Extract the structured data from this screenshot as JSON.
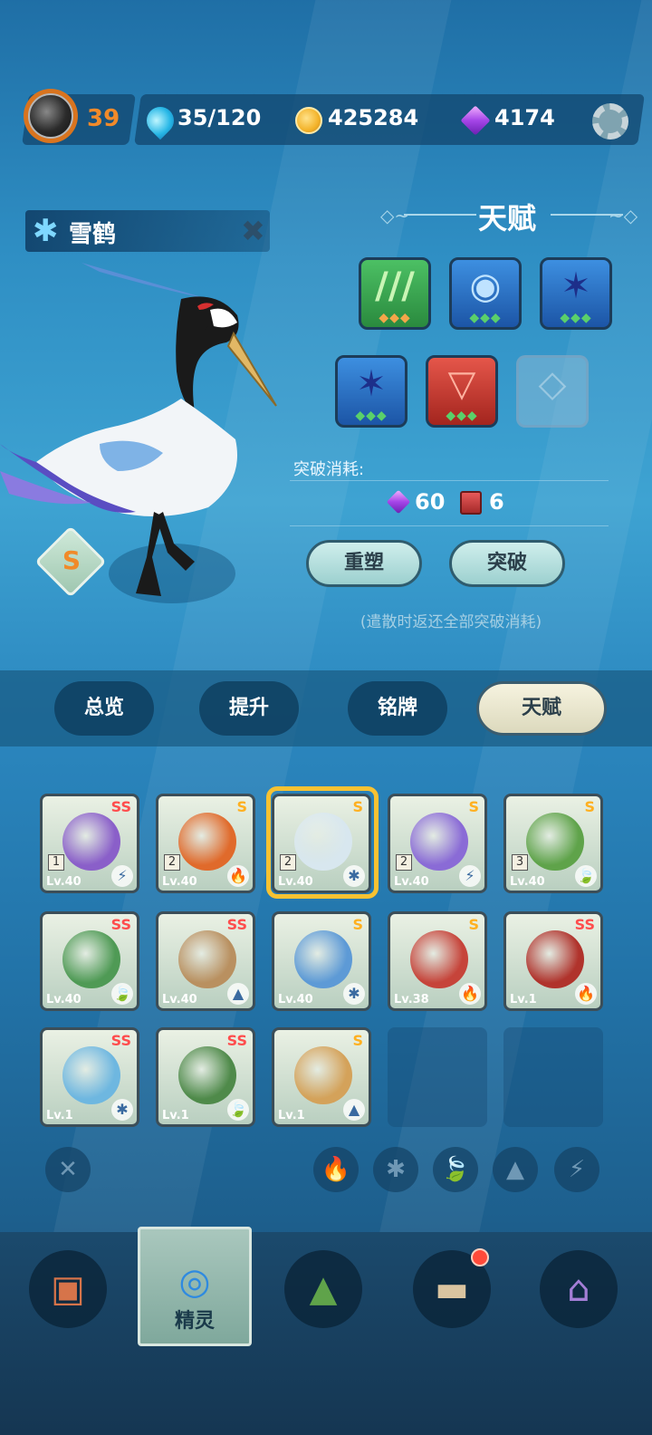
{
  "header": {
    "player_level": "39",
    "stamina": "35/120",
    "coins": "425284",
    "gems": "4174"
  },
  "spirit": {
    "name": "雪鹤",
    "rank": "S"
  },
  "talent": {
    "title": "天赋",
    "break_label": "突破消耗:",
    "cost_gems": "60",
    "cost_books": "6",
    "reshape_label": "重塑",
    "break_label_btn": "突破",
    "hint": "(遣散时返还全部突破消耗)",
    "slots": [
      {
        "glyph": "///",
        "color": "green",
        "pips": "◆◆◆"
      },
      {
        "glyph": "◉",
        "color": "blue",
        "pips": "◆◆◆"
      },
      {
        "glyph": "✶",
        "color": "blue",
        "pips": "◆◆◆"
      },
      {
        "glyph": "✶",
        "color": "blue",
        "pips": "◆◆◆"
      },
      {
        "glyph": "▽",
        "color": "red",
        "pips": "◆◆◆"
      },
      {
        "glyph": "◇",
        "color": "empty",
        "pips": ""
      }
    ]
  },
  "tabs": [
    {
      "label": "总览"
    },
    {
      "label": "提升"
    },
    {
      "label": "铭牌"
    },
    {
      "label": "天赋"
    }
  ],
  "spirits": [
    {
      "rank": "SS",
      "star": "1",
      "lv": "Lv.40",
      "elem": "⚡",
      "color": "#8a5fc9"
    },
    {
      "rank": "S",
      "star": "2",
      "lv": "Lv.40",
      "elem": "🔥",
      "color": "#e06a2b"
    },
    {
      "rank": "S",
      "star": "2",
      "lv": "Lv.40",
      "elem": "✱",
      "color": "#d8e7ef"
    },
    {
      "rank": "S",
      "star": "2",
      "lv": "Lv.40",
      "elem": "⚡",
      "color": "#8a6bd6"
    },
    {
      "rank": "S",
      "star": "3",
      "lv": "Lv.40",
      "elem": "🍃",
      "color": "#5fa34a"
    },
    {
      "rank": "SS",
      "star": "",
      "lv": "Lv.40",
      "elem": "🍃",
      "color": "#4f9a55"
    },
    {
      "rank": "SS",
      "star": "",
      "lv": "Lv.40",
      "elem": "▲",
      "color": "#b99060"
    },
    {
      "rank": "S",
      "star": "",
      "lv": "Lv.40",
      "elem": "✱",
      "color": "#5d9ad6"
    },
    {
      "rank": "S",
      "star": "",
      "lv": "Lv.38",
      "elem": "🔥",
      "color": "#c6443a"
    },
    {
      "rank": "SS",
      "star": "",
      "lv": "Lv.1",
      "elem": "🔥",
      "color": "#b0332c"
    },
    {
      "rank": "SS",
      "star": "",
      "lv": "Lv.1",
      "elem": "✱",
      "color": "#6eb7e0"
    },
    {
      "rank": "SS",
      "star": "",
      "lv": "Lv.1",
      "elem": "🍃",
      "color": "#4f8a4a"
    },
    {
      "rank": "S",
      "star": "",
      "lv": "Lv.1",
      "elem": "▲",
      "color": "#d4a25a"
    }
  ],
  "filters": [
    "✕",
    "🔥",
    "✱",
    "🍃",
    "▲",
    "⚡"
  ],
  "nav": {
    "active_label": "精灵"
  },
  "colors": {
    "accent_orange": "#f08a2a",
    "rank_ss": "#ff4d4d",
    "rank_s": "#ffb020",
    "selection": "#f7c232"
  }
}
